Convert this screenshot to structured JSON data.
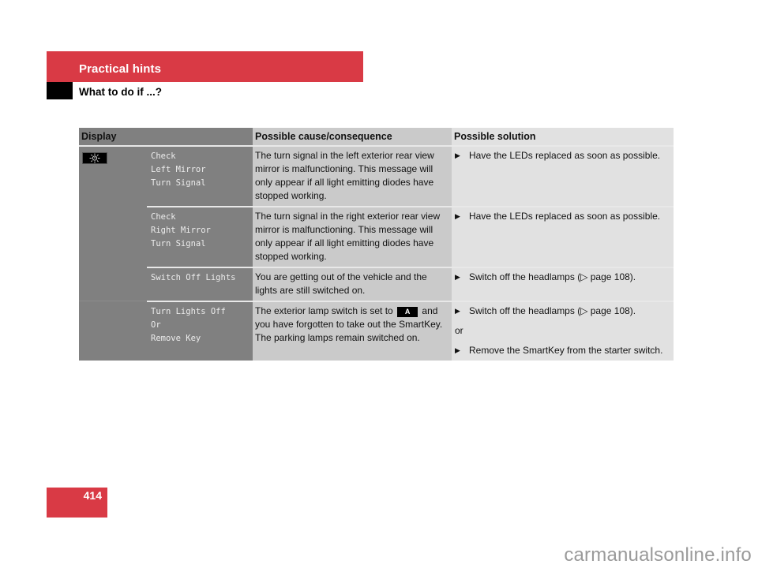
{
  "header": {
    "section_title": "Practical hints",
    "subtitle": "What to do if ...?"
  },
  "table": {
    "columns": {
      "display": "Display",
      "cause": "Possible cause/consequence",
      "solution": "Possible solution"
    },
    "rows": [
      {
        "icon": "turn-signal-lamp-icon",
        "message": "Check\nLeft Mirror\nTurn Signal",
        "cause": "The turn signal in the left exterior rear view mirror is malfunctioning. This message will only appear if all light emitting diodes have stopped working.",
        "solutions": [
          "Have the LEDs replaced as soon as possible."
        ]
      },
      {
        "message": "Check\nRight Mirror\nTurn Signal",
        "cause": "The turn signal in the right exterior rear view mirror is malfunctioning. This message will only appear if all light emitting diodes have stopped working.",
        "solutions": [
          "Have the LEDs replaced as soon as possible."
        ]
      },
      {
        "message": "Switch Off Lights",
        "cause": "You are getting out of the vehicle and the lights are still switched on.",
        "solutions": [
          "Switch off the headlamps (▷ page 108)."
        ]
      },
      {
        "message": "Turn Lights Off\nOr\nRemove Key",
        "cause_before": "The exterior lamp switch is set to",
        "cause_key": "A",
        "cause_after": "and you have forgotten to take out the SmartKey. The parking lamps remain switched on.",
        "solutions": [
          "Switch off the headlamps (▷ page 108).",
          "Remove the SmartKey from the starter switch."
        ],
        "solution_separator": "or"
      }
    ]
  },
  "bullet_glyph": "▶",
  "footer": {
    "page_number": "414",
    "watermark": "carmanualsonline.info"
  }
}
